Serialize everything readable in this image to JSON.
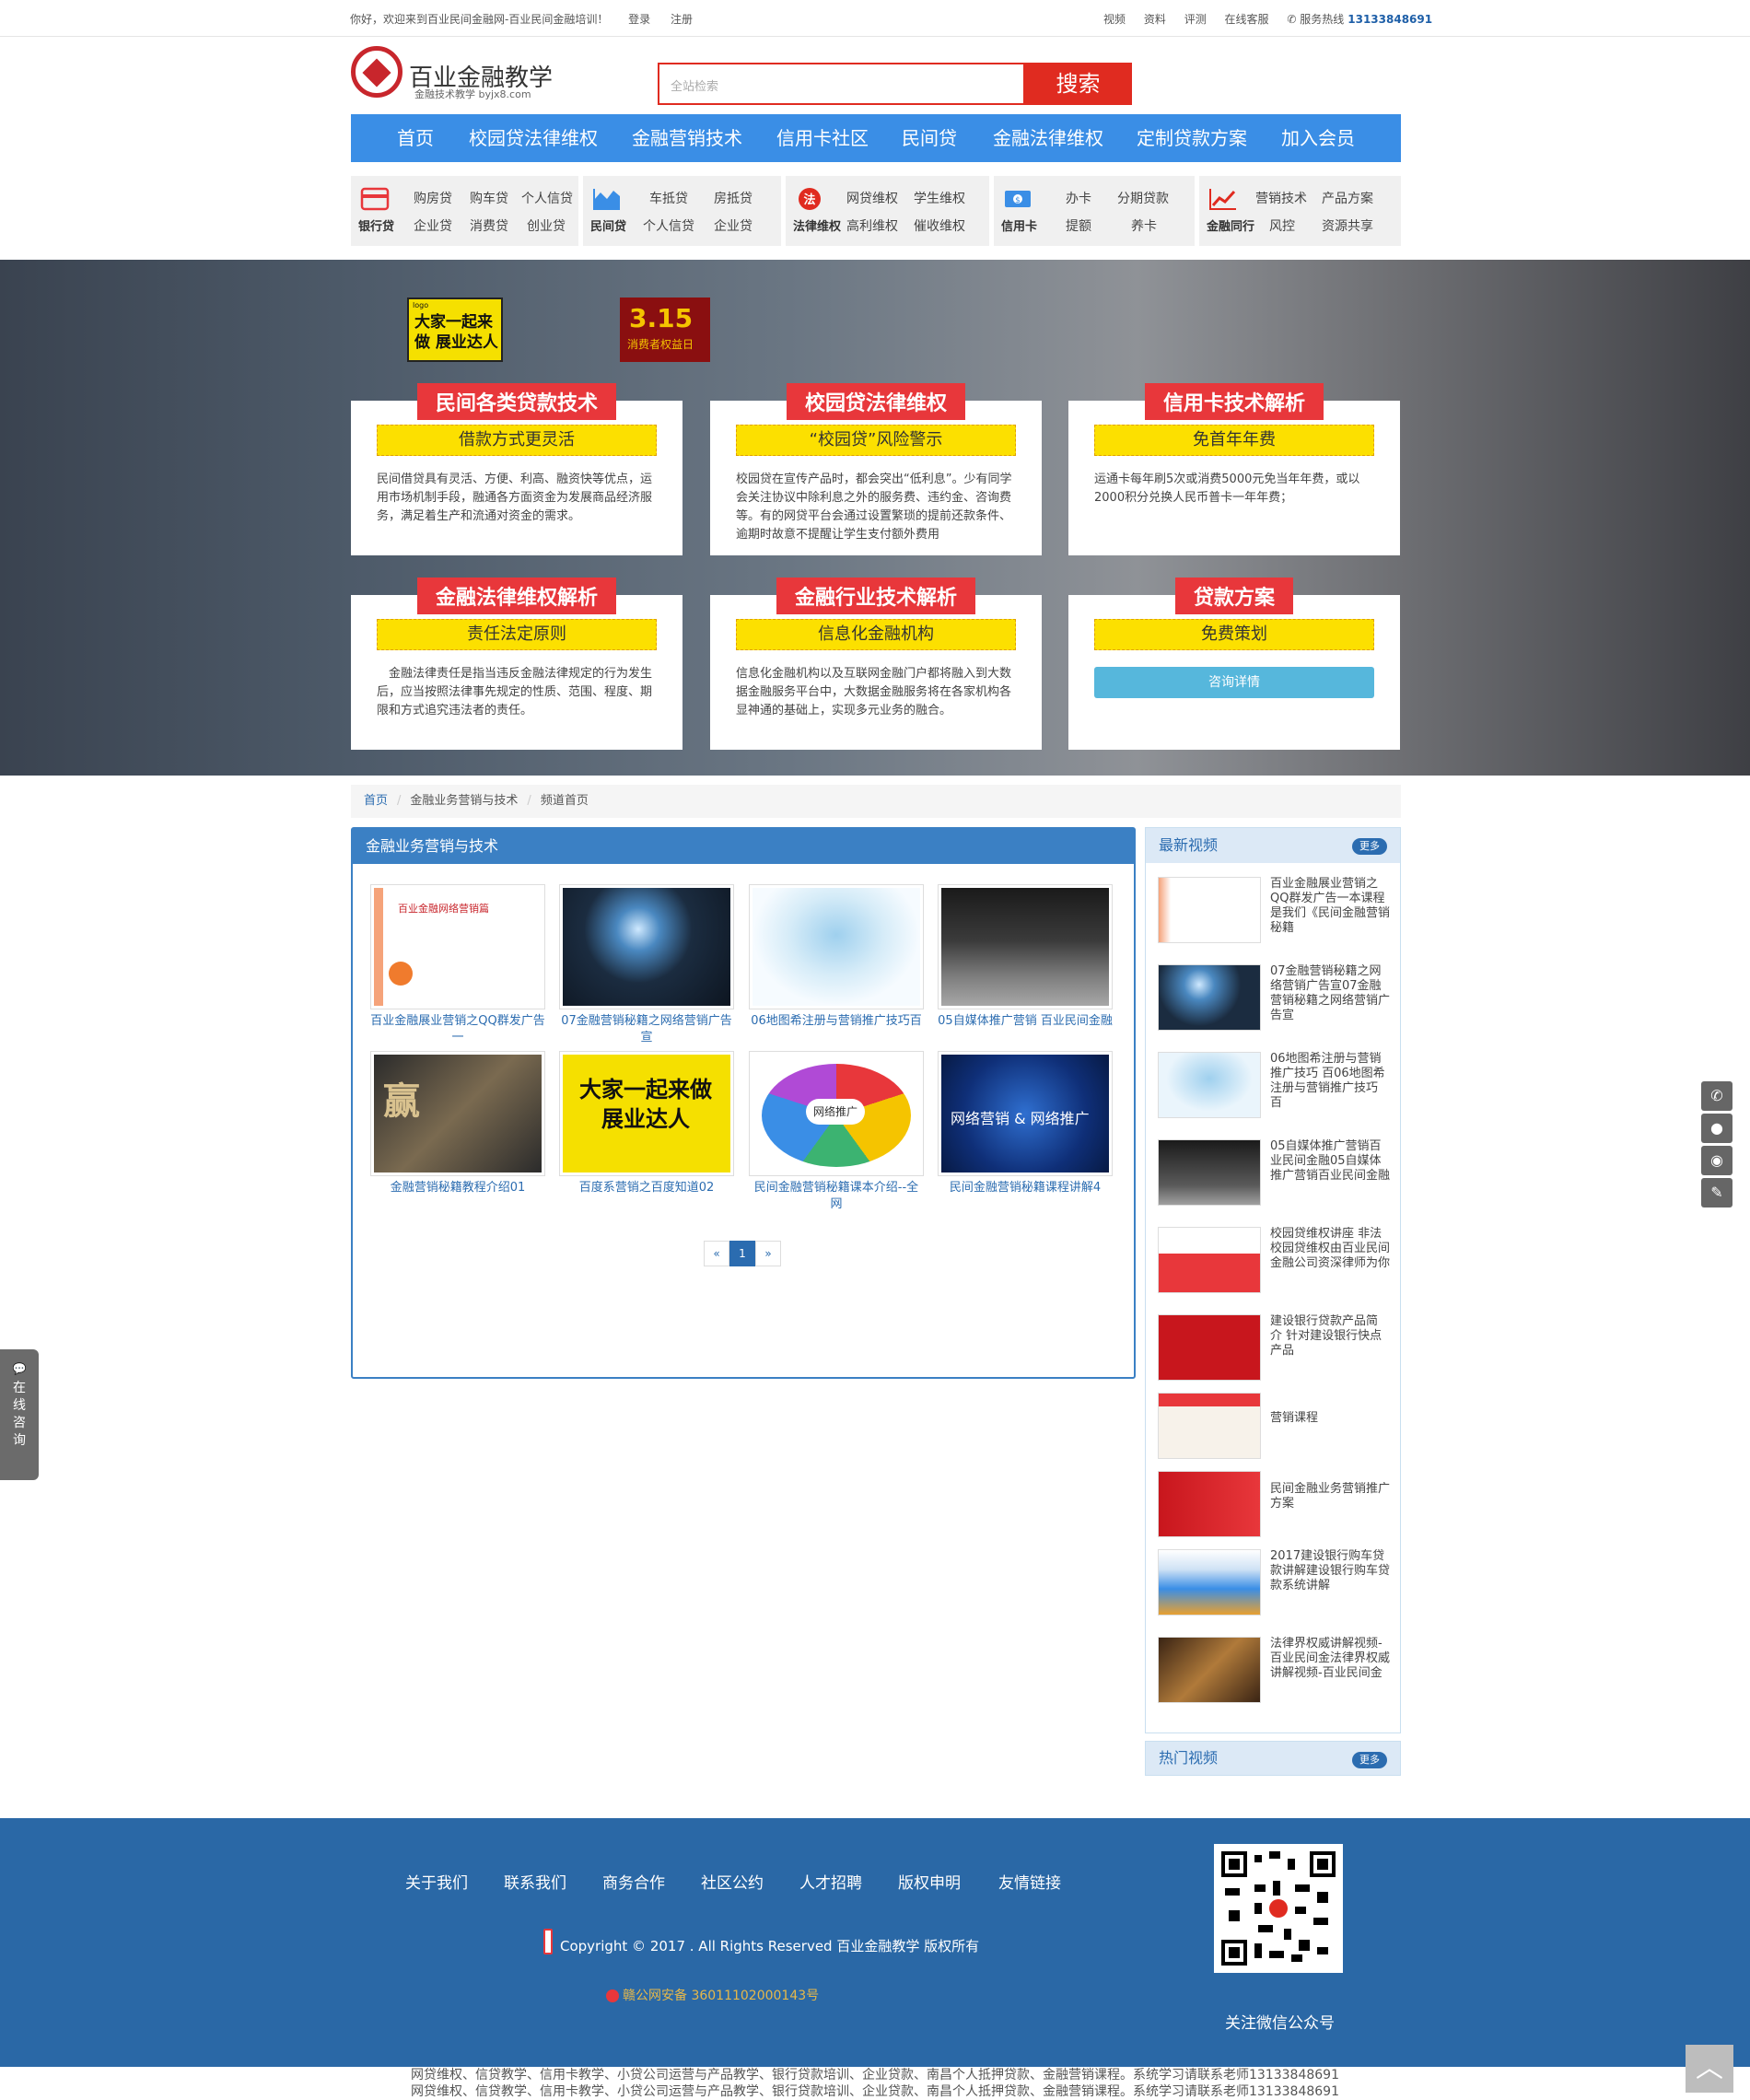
{
  "topbar": {
    "greeting": "你好，欢迎来到百业民间金融网-百业民间金融培训！",
    "login": "登录",
    "register": "注册",
    "links": [
      "视频",
      "资料",
      "评测",
      "在线客服"
    ],
    "hotline_label": "✆ 服务热线",
    "hotline": "13133848691"
  },
  "header": {
    "logo_title": "百业金融教学",
    "logo_sub": "金融技术教学 byjx8.com",
    "search_placeholder": "全站检索",
    "search_button": "搜索"
  },
  "nav": [
    "首页",
    "校园贷法律维权",
    "金融营销技术",
    "信用卡社区",
    "民间贷",
    "金融法律维权",
    "定制贷款方案",
    "加入会员"
  ],
  "categories": [
    {
      "name": "银行贷",
      "links": [
        "购房贷",
        "购车贷",
        "个人信贷",
        "企业贷",
        "消费贷",
        "创业贷"
      ]
    },
    {
      "name": "民间贷",
      "links": [
        "车抵贷",
        "房抵贷",
        "个人信贷",
        "企业贷"
      ]
    },
    {
      "name": "法律维权",
      "links": [
        "网贷维权",
        "学生维权",
        "高利维权",
        "催收维权"
      ]
    },
    {
      "name": "信用卡",
      "links": [
        "办卡",
        "分期贷款",
        "提额",
        "养卡"
      ]
    },
    {
      "name": "金融同行",
      "links": [
        "营销技术",
        "产品方案",
        "风控",
        "资源共享"
      ]
    }
  ],
  "banner": {
    "promo1_logo": "logo",
    "promo1": "大家一起来做 展业达人",
    "promo2_title": "3.15",
    "promo2_sub": "消费者权益日",
    "cards": [
      {
        "title": "民间各类贷款技术",
        "bar": "借款方式更灵活",
        "text": "民间借贷具有灵活、方便、利高、融资快等优点，运用市场机制手段，融通各方面资金为发展商品经济服务，满足着生产和流通对资金的需求。"
      },
      {
        "title": "校园贷法律维权",
        "bar": "“校园贷”风险警示",
        "text": "校园贷在宣传产品时，都会突出“低利息”。少有同学会关注协议中除利息之外的服务费、违约金、咨询费等。有的网贷平台会通过设置繁琐的提前还款条件、逾期时故意不提醒让学生支付额外费用"
      },
      {
        "title": "信用卡技术解析",
        "bar": "免首年年费",
        "text": "运通卡每年刷5次或消费5000元免当年年费，或以2000积分兑换人民币普卡一年年费；"
      },
      {
        "title": "金融法律维权解析",
        "bar": "责任法定原则",
        "text": "　金融法律责任是指当违反金融法律规定的行为发生后，应当按照法律事先规定的性质、范围、程度、期限和方式追究违法者的责任。"
      },
      {
        "title": "金融行业技术解析",
        "bar": "信息化金融机构",
        "text": "信息化金融机构以及互联网金融门户都将融入到大数据金融服务平台中，大数据金融服务将在各家机构各显神通的基础上，实现多元业务的融合。"
      },
      {
        "title": "贷款方案",
        "bar": "免费策划",
        "button": "咨询详情"
      }
    ]
  },
  "breadcrumb": [
    "首页",
    "金融业务营销与技术",
    "频道首页"
  ],
  "main": {
    "title": "金融业务营销与技术",
    "items": [
      {
        "caption": "百业金融展业营销之QQ群发广告一",
        "img_title": "百业金融网络营销篇"
      },
      {
        "caption": "07金融营销秘籍之网络营销广告宣",
        "img_title": ""
      },
      {
        "caption": "06地图希注册与营销推广技巧百",
        "img_title": ""
      },
      {
        "caption": "05自媒体推广营销 百业民间金融",
        "img_title": ""
      },
      {
        "caption": "金融营销秘籍教程介绍01",
        "img_title": "赢"
      },
      {
        "caption": "百度系营销之百度知道02",
        "img_title": "大家一起来做 展业达人"
      },
      {
        "caption": "民间金融营销秘籍课本介绍--全网",
        "img_title": "网络推广"
      },
      {
        "caption": "民间金融营销秘籍课程讲解4",
        "img_title": "网络营销 & 网络推广"
      }
    ],
    "pager": [
      "«",
      "1",
      "»"
    ]
  },
  "sidebar": {
    "title": "最新视频",
    "more": "更多",
    "videos": [
      "百业金融展业营销之QQ群发广告一本课程是我们《民间金融营销秘籍",
      "07金融营销秘籍之网络营销广告宣07金融营销秘籍之网络营销广告宣",
      "06地图希注册与营销推广技巧 百06地图希注册与营销推广技巧 百",
      "05自媒体推广营销百业民间金融05自媒体推广营销百业民间金融",
      "校园贷维权讲座 非法校园贷维权由百业民间金融公司资深律师为你",
      "建设银行贷款产品简 介 针对建设银行快点产品",
      "营销课程",
      "民间金融业务营销推广方案",
      "2017建设银行购车贷款讲解建设银行购车贷款系统讲解",
      "法律界权威讲解视频-百业民间金法律界权威讲解视频-百业民间金"
    ],
    "hot_title": "热门视频",
    "hot_more": "更多"
  },
  "float": {
    "consult": "在线咨询"
  },
  "footer": {
    "links": [
      "关于我们",
      "联系我们",
      "商务合作",
      "社区公约",
      "人才招聘",
      "版权申明",
      "友情链接"
    ],
    "copyright": "Copyright © 2017 . All Rights Reserved 百业金融教学 版权所有",
    "police": "赣公网安备 36011102000143号",
    "qr_label": "关注微信公众号"
  },
  "seo": [
    "网贷维权、信贷教学、信用卡教学、小贷公司运营与产品教学、银行贷款培训、企业贷款、南昌个人抵押贷款、金融营销课程。系统学习请联系老师13133848691",
    "网贷维权、信贷教学、信用卡教学、小贷公司运营与产品教学、银行贷款培训、企业贷款、南昌个人抵押贷款、金融营销课程。系统学习请联系老师13133848691"
  ],
  "colors": {
    "nav": "#3a8ee6",
    "accent": "#e02b20",
    "card_title": "#e8373b",
    "bar": "#fce000",
    "footer": "#2a68a6",
    "link": "#2b6cb0"
  }
}
